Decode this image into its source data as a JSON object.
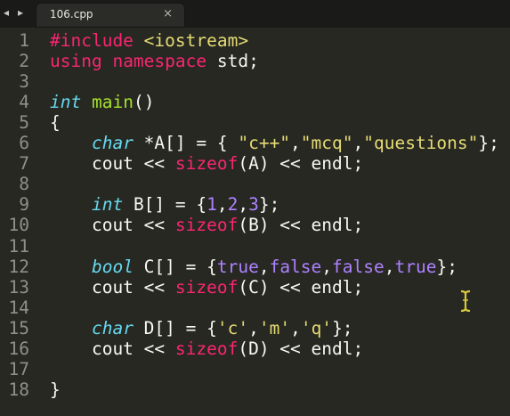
{
  "tab": {
    "nav_left": "◂",
    "nav_right": "▸",
    "title": "106.cpp",
    "close": "×"
  },
  "editor": {
    "lines": [
      {
        "n": "1",
        "tokens": [
          [
            "pre",
            "#include "
          ],
          [
            "str",
            "<iostream>"
          ]
        ]
      },
      {
        "n": "2",
        "tokens": [
          [
            "kw",
            "using "
          ],
          [
            "kw",
            "namespace "
          ],
          [
            "plain",
            "std;"
          ]
        ]
      },
      {
        "n": "3",
        "tokens": []
      },
      {
        "n": "4",
        "tokens": [
          [
            "type",
            "int"
          ],
          [
            "plain",
            " "
          ],
          [
            "fn",
            "main"
          ],
          [
            "plain",
            "()"
          ]
        ]
      },
      {
        "n": "5",
        "tokens": [
          [
            "plain",
            "{"
          ]
        ]
      },
      {
        "n": "6",
        "tokens": [
          [
            "plain",
            "    "
          ],
          [
            "type",
            "char"
          ],
          [
            "plain",
            " *A[] = { "
          ],
          [
            "str",
            "\"c++\""
          ],
          [
            "plain",
            ","
          ],
          [
            "str",
            "\"mcq\""
          ],
          [
            "plain",
            ","
          ],
          [
            "str",
            "\"questions\""
          ],
          [
            "plain",
            "};"
          ]
        ]
      },
      {
        "n": "7",
        "tokens": [
          [
            "plain",
            "    cout << "
          ],
          [
            "sizeof",
            "sizeof"
          ],
          [
            "plain",
            "(A) << endl;"
          ]
        ]
      },
      {
        "n": "8",
        "tokens": []
      },
      {
        "n": "9",
        "tokens": [
          [
            "plain",
            "    "
          ],
          [
            "type",
            "int"
          ],
          [
            "plain",
            " B[] = {"
          ],
          [
            "num",
            "1"
          ],
          [
            "plain",
            ","
          ],
          [
            "num",
            "2"
          ],
          [
            "plain",
            ","
          ],
          [
            "num",
            "3"
          ],
          [
            "plain",
            "};"
          ]
        ]
      },
      {
        "n": "10",
        "tokens": [
          [
            "plain",
            "    cout << "
          ],
          [
            "sizeof",
            "sizeof"
          ],
          [
            "plain",
            "(B) << endl;"
          ]
        ]
      },
      {
        "n": "11",
        "tokens": []
      },
      {
        "n": "12",
        "tokens": [
          [
            "plain",
            "    "
          ],
          [
            "type",
            "bool"
          ],
          [
            "plain",
            " C[] = {"
          ],
          [
            "const",
            "true"
          ],
          [
            "plain",
            ","
          ],
          [
            "const",
            "false"
          ],
          [
            "plain",
            ","
          ],
          [
            "const",
            "false"
          ],
          [
            "plain",
            ","
          ],
          [
            "const",
            "true"
          ],
          [
            "plain",
            "};"
          ]
        ]
      },
      {
        "n": "13",
        "tokens": [
          [
            "plain",
            "    cout << "
          ],
          [
            "sizeof",
            "sizeof"
          ],
          [
            "plain",
            "(C) << endl;"
          ]
        ]
      },
      {
        "n": "14",
        "tokens": []
      },
      {
        "n": "15",
        "tokens": [
          [
            "plain",
            "    "
          ],
          [
            "type",
            "char"
          ],
          [
            "plain",
            " D[] = {"
          ],
          [
            "str",
            "'c'"
          ],
          [
            "plain",
            ","
          ],
          [
            "str",
            "'m'"
          ],
          [
            "plain",
            ","
          ],
          [
            "str",
            "'q'"
          ],
          [
            "plain",
            "};"
          ]
        ]
      },
      {
        "n": "16",
        "tokens": [
          [
            "plain",
            "    cout << "
          ],
          [
            "sizeof",
            "sizeof"
          ],
          [
            "plain",
            "(D) << endl;"
          ]
        ]
      },
      {
        "n": "17",
        "tokens": []
      },
      {
        "n": "18",
        "tokens": [
          [
            "plain",
            "}"
          ]
        ]
      }
    ]
  },
  "colors": {
    "background": "#272822",
    "keyword": "#f92672",
    "type": "#66d9ef",
    "function": "#a6e22e",
    "string": "#e6db74",
    "number": "#ae81ff",
    "line_number": "#8f908a"
  },
  "mouse_cursor": "i-beam-cursor-icon"
}
